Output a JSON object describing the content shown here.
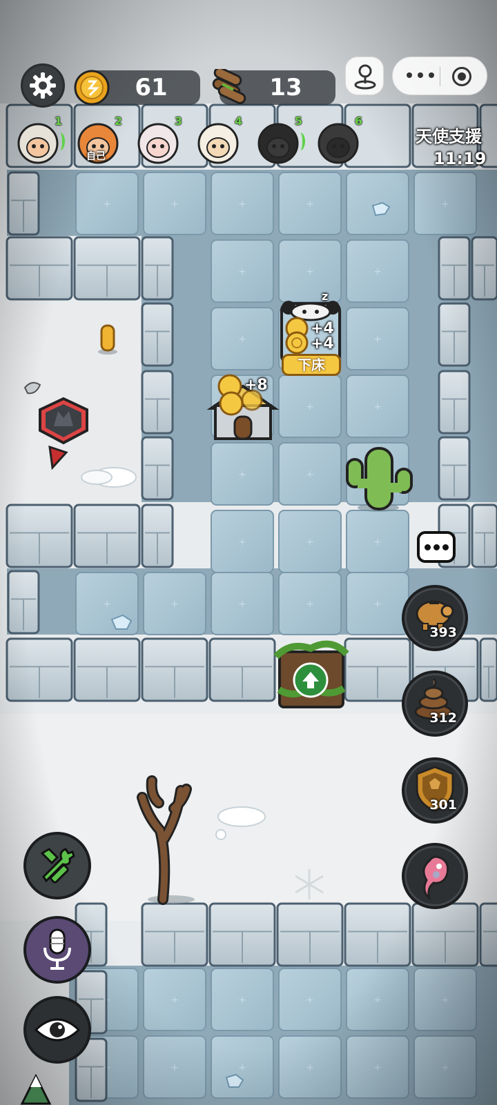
{
  "hud": {
    "coins": "61",
    "wood": "13",
    "icons": {
      "settings": "gear-icon",
      "coin": "coin-icon",
      "wood": "wood-logs-icon",
      "miniprogram_menu": "more-dots-icon",
      "miniprogram_close": "target-circle-icon",
      "joystick": "joystick-icon"
    }
  },
  "players": [
    {
      "number": "1",
      "character": "bald-sheep-avatar",
      "tag": "",
      "signal": true
    },
    {
      "number": "2",
      "character": "tiger-hood-sheep-avatar",
      "tag": "自己",
      "signal": false
    },
    {
      "number": "3",
      "character": "pink-bow-sheep-avatar",
      "tag": "",
      "signal": false
    },
    {
      "number": "4",
      "character": "white-fluffy-sheep-avatar",
      "tag": "",
      "signal": false
    },
    {
      "number": "5",
      "character": "black-sheep-avatar",
      "tag": "",
      "signal": true
    },
    {
      "number": "6",
      "character": "dark-sheep-avatar",
      "tag": "",
      "signal": false
    }
  ],
  "support": {
    "label": "天使支援",
    "timer": "11:19"
  },
  "map": {
    "bed_popup": {
      "plus_a": "+4",
      "plus_b": "+4",
      "action": "下床",
      "status": "z"
    },
    "house_popup": {
      "plus": "+8"
    },
    "objects": [
      "coin-pickup",
      "wolf-marker-icon",
      "cactus",
      "thorn-gate-upgrade",
      "dead-tree",
      "snowflake-mark",
      "ice-crystal"
    ]
  },
  "resources": [
    {
      "name": "piggy-bank-icon",
      "value": "393"
    },
    {
      "name": "poop-icon",
      "value": "312"
    },
    {
      "name": "shield-icon",
      "value": "301"
    },
    {
      "name": "pink-potion-icon",
      "value": ""
    }
  ],
  "actions": {
    "build": "tools-icon",
    "voice": "microphone-icon",
    "view": "eye-icon",
    "chat": "chat-bubble-icon"
  },
  "colors": {
    "ice_floor": "#a9c4d3",
    "stone_wall": "#c3cfd6",
    "wall_dark": "#4c6070",
    "snow": "#eef0f1",
    "accent_green": "#5fd24a",
    "bed_label": "#f5c842"
  }
}
